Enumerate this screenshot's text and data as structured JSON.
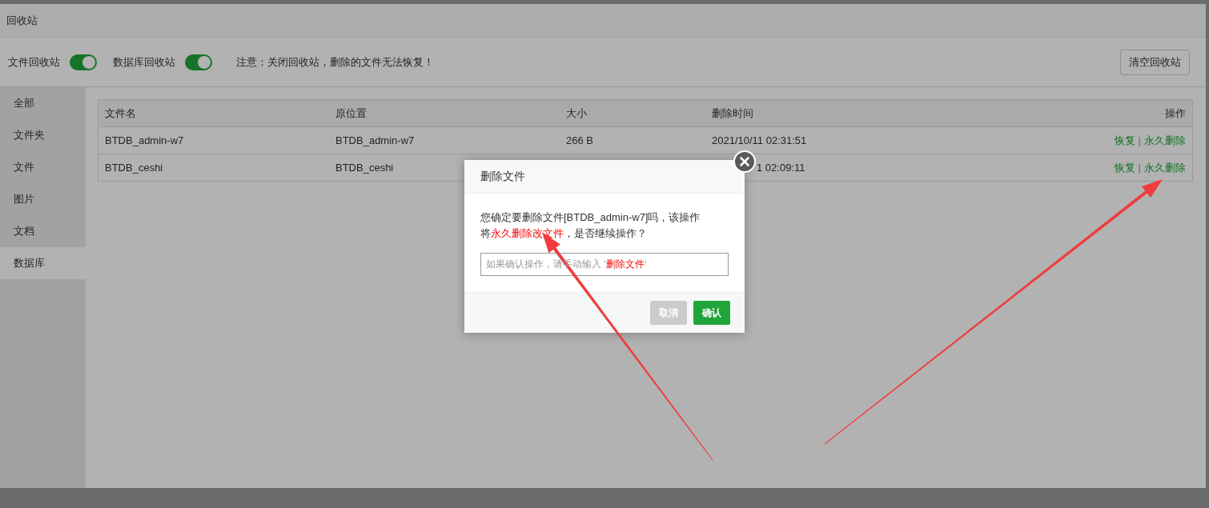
{
  "window": {
    "title": "回收站"
  },
  "toolbar": {
    "toggles": [
      {
        "label": "文件回收站",
        "on": true
      },
      {
        "label": "数据库回收站",
        "on": true
      }
    ],
    "notice": "注意：关闭回收站，删除的文件无法恢复！",
    "clear_button": "清空回收站"
  },
  "sidebar": {
    "items": [
      {
        "label": "全部",
        "selected": false
      },
      {
        "label": "文件夹",
        "selected": false
      },
      {
        "label": "文件",
        "selected": false
      },
      {
        "label": "图片",
        "selected": false
      },
      {
        "label": "文档",
        "selected": false
      },
      {
        "label": "数据库",
        "selected": true
      }
    ]
  },
  "table": {
    "columns": [
      "文件名",
      "原位置",
      "大小",
      "删除时间",
      "操作"
    ],
    "rows": [
      {
        "cells": [
          "BTDB_admin-w7",
          "BTDB_admin-w7",
          "266 B",
          "2021/10/11 02:31:51"
        ],
        "actions": [
          "恢复",
          "|",
          "永久删除"
        ]
      },
      {
        "cells": [
          "BTDB_ceshi",
          "BTDB_ceshi",
          "",
          "1 02:09:11"
        ],
        "actions": [
          "恢复",
          "|",
          "永久删除"
        ]
      }
    ]
  },
  "dialog": {
    "title": "删除文件",
    "message": [
      {
        "text": "您确定要删除文件[BTDB_admin-w7]吗，该操作将",
        "highlight": false
      },
      {
        "text": "永久删除改文件",
        "highlight": true
      },
      {
        "text": "，是否继续操作？",
        "highlight": false
      }
    ],
    "placeholder": [
      {
        "text": "如果确认操作，请手动输入 ‘",
        "highlight": false
      },
      {
        "text": "删除文件",
        "highlight": true
      },
      {
        "text": "’",
        "highlight": false
      }
    ],
    "buttons": [
      {
        "label": "取消",
        "kind": "cancel"
      },
      {
        "label": "确认",
        "kind": "confirm"
      }
    ]
  },
  "annotations": [
    {
      "kind": "arrow"
    },
    {
      "kind": "arrow"
    }
  ]
}
